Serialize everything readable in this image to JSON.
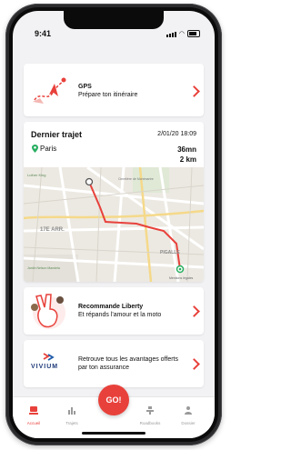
{
  "status_bar": {
    "time": "9:41"
  },
  "gps_card": {
    "title": "GPS",
    "subtitle": "Prépare ton itinéraire"
  },
  "last_trip": {
    "title": "Dernier trajet",
    "date": "2/01/20 18:09",
    "city": "Paris",
    "duration": "36mn",
    "distance": "2 km",
    "map_labels": {
      "arr": "17E ARR.",
      "pigalle": "PIGALLE",
      "luther": "Luther King",
      "cimetiere": "Cimetière de Montmartre",
      "jardin": "Jardin Nelson Mandela",
      "legal": "Mentions légales"
    }
  },
  "liberty_card": {
    "title": "Recommande Liberty",
    "subtitle": "Et répands l'amour et la moto"
  },
  "vivium_card": {
    "logo_text": "VIVIUM",
    "line1": "Retrouve tous les avantages offerts",
    "line2": "par ton assurance"
  },
  "tabbar": {
    "tabs": [
      {
        "label": "Accueil",
        "active": true
      },
      {
        "label": "Trajets",
        "active": false
      },
      {
        "label": "Roadbooks",
        "active": false
      },
      {
        "label": "Dossier",
        "active": false
      }
    ],
    "go_label": "GO!"
  },
  "accent_color": "#e8413b"
}
